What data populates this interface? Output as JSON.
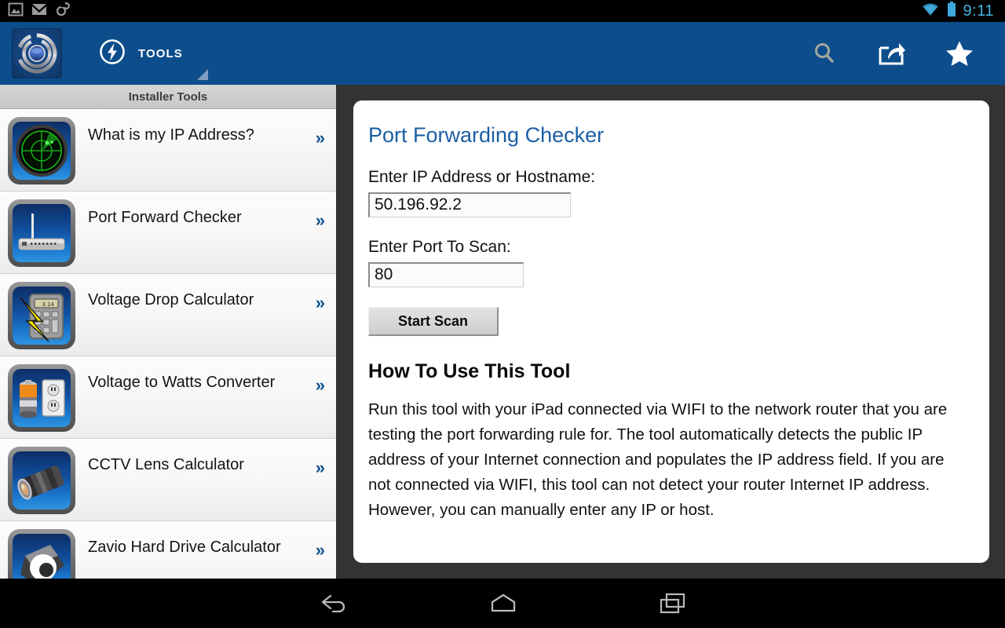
{
  "statusbar": {
    "icons": [
      "gallery-image-icon",
      "gmail-icon",
      "sync-link-icon"
    ],
    "wifi_icon": "wifi-icon",
    "battery_icon": "battery-icon",
    "time": "9:11",
    "time_color": "#43b4e0"
  },
  "actionbar": {
    "background_color": "#0d4d8c",
    "app_logo_name": "app-logo-lens-icon",
    "tab_icon": "lightning-bolt-circle-icon",
    "tab_label": "TOOLS",
    "actions": [
      {
        "name": "search-icon",
        "label": "Search"
      },
      {
        "name": "share-icon",
        "label": "Share"
      },
      {
        "name": "star-icon",
        "label": "Favorite"
      }
    ]
  },
  "sidebar": {
    "header": "Installer Tools",
    "chevron": "»",
    "items": [
      {
        "label": "What is my IP Address?",
        "icon": "radar-icon"
      },
      {
        "label": "Port Forward Checker",
        "icon": "router-icon"
      },
      {
        "label": "Voltage Drop Calculator",
        "icon": "calculator-lightning-icon"
      },
      {
        "label": "Voltage to Watts Converter",
        "icon": "battery-outlet-icon"
      },
      {
        "label": "CCTV Lens Calculator",
        "icon": "camera-lens-icon"
      },
      {
        "label": "Zavio Hard Drive Calculator",
        "icon": "zavio-logo-icon"
      }
    ]
  },
  "main": {
    "card_title": "Port Forwarding Checker",
    "card_title_color": "#1b5ea5",
    "ip_label": "Enter IP Address or Hostname:",
    "ip_value": "50.196.92.2",
    "ip_placeholder": "Enter IP Address or Hostname",
    "port_label": "Enter Port To Scan:",
    "port_value": "80",
    "port_placeholder": "Enter Port",
    "scan_button": "Start Scan",
    "howto_title": "How To Use This Tool",
    "howto_body": "Run this tool with your iPad connected via WIFI to the network router that you are testing the port forwarding rule for. The tool automatically detects the public IP address of your Internet connection and populates the IP address field. If you are not connected via WIFI, this tool can not detect your router Internet IP address. However, you can manually enter any IP or host."
  },
  "navbar": {
    "buttons": [
      {
        "name": "nav-back-icon",
        "label": "Back"
      },
      {
        "name": "nav-home-icon",
        "label": "Home"
      },
      {
        "name": "nav-recents-icon",
        "label": "Recent apps"
      }
    ]
  }
}
